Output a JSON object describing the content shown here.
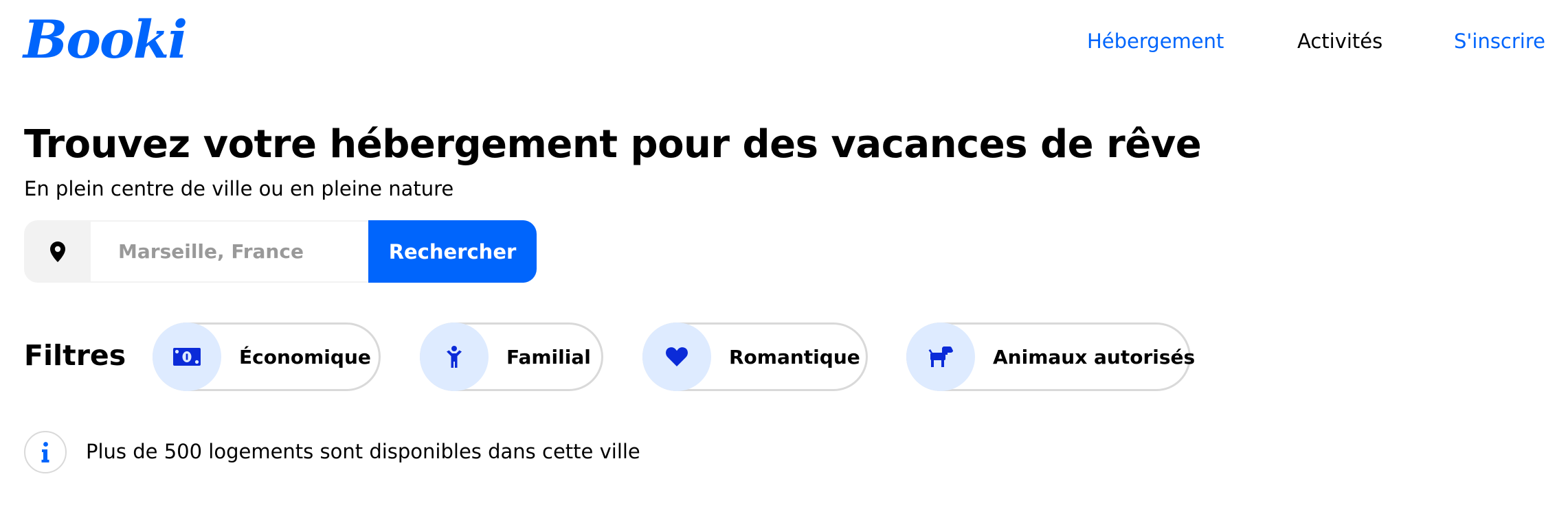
{
  "header": {
    "logo_text": "Booki",
    "nav": {
      "hebergement": "Hébergement",
      "activites": "Activités",
      "inscrire": "S'inscrire"
    }
  },
  "hero": {
    "title": "Trouvez votre hébergement pour des vacances de rêve",
    "subtitle": "En plein centre de ville ou en pleine nature"
  },
  "search": {
    "icon": "location-pin-icon",
    "placeholder": "Marseille, France",
    "value": "",
    "button_label": "Rechercher"
  },
  "filters": {
    "label": "Filtres",
    "items": [
      {
        "label": "Économique",
        "icon": "money-bill-icon"
      },
      {
        "label": "Familial",
        "icon": "child-icon"
      },
      {
        "label": "Romantique",
        "icon": "heart-icon"
      },
      {
        "label": "Animaux autorisés",
        "icon": "dog-icon"
      }
    ]
  },
  "info": {
    "icon": "info-icon",
    "text": "Plus de 500 logements sont disponibles dans cette ville"
  },
  "colors": {
    "accent": "#0065fc",
    "icon_blue": "#0b2bd8",
    "chip_icon_background": "#deebff",
    "chip_border": "#d9d9d9",
    "search_icon_background": "#f2f2f2",
    "placeholder": "#999999"
  }
}
